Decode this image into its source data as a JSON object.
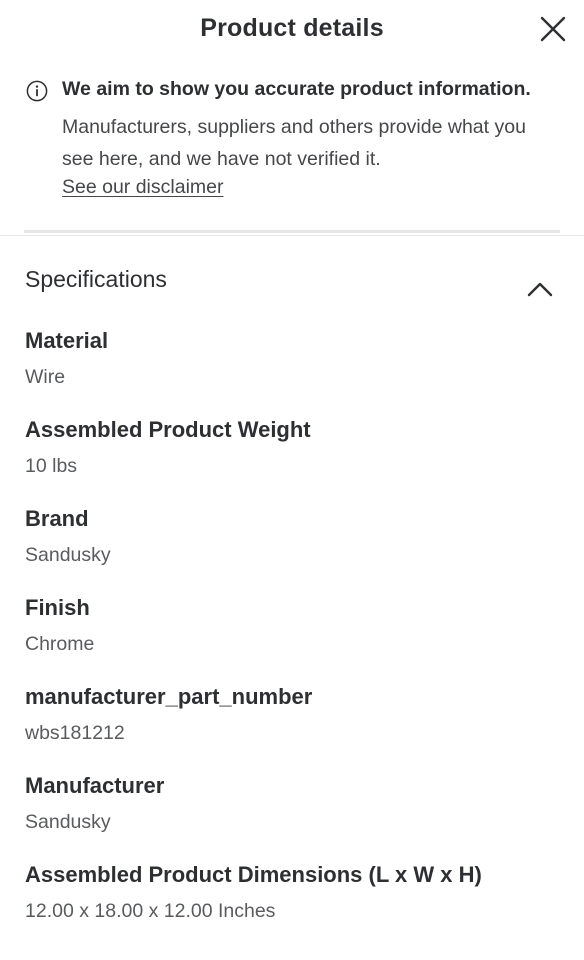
{
  "header": {
    "title": "Product details",
    "close_icon": "close-icon"
  },
  "notice": {
    "icon": "info-icon",
    "headline": "We aim to show you accurate product information.",
    "body": "Manufacturers, suppliers and others provide what you see here, and we have not verified it.",
    "link": "See our disclaimer"
  },
  "specifications": {
    "title": "Specifications",
    "expanded": true,
    "toggle_icon": "chevron-up-icon",
    "items": [
      {
        "label": "Material",
        "value": "Wire"
      },
      {
        "label": "Assembled Product Weight",
        "value": "10 lbs"
      },
      {
        "label": "Brand",
        "value": "Sandusky"
      },
      {
        "label": "Finish",
        "value": "Chrome"
      },
      {
        "label": "manufacturer_part_number",
        "value": "wbs181212"
      },
      {
        "label": "Manufacturer",
        "value": "Sandusky"
      },
      {
        "label": "Assembled Product Dimensions (L x W x H)",
        "value": "12.00 x 18.00 x 12.00 Inches"
      }
    ]
  }
}
